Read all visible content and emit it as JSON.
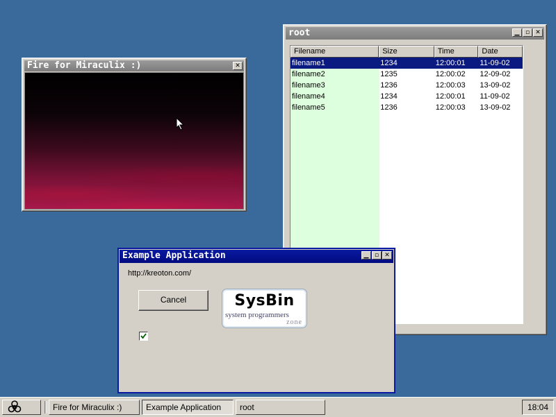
{
  "fire_window": {
    "title": "Fire for Miraculix :)",
    "close_glyph": "✕"
  },
  "root_window": {
    "title": "root",
    "columns": [
      "Filename",
      "Size",
      "Time",
      "Date"
    ],
    "rows": [
      {
        "filename": "filename1",
        "size": "1234",
        "time": "12:00:01",
        "date": "11-09-02"
      },
      {
        "filename": "filename2",
        "size": "1235",
        "time": "12:00:02",
        "date": "12-09-02"
      },
      {
        "filename": "filename3",
        "size": "1236",
        "time": "12:00:03",
        "date": "13-09-02"
      },
      {
        "filename": "filename4",
        "size": "1234",
        "time": "12:00:01",
        "date": "11-09-02"
      },
      {
        "filename": "filename5",
        "size": "1236",
        "time": "12:00:03",
        "date": "13-09-02"
      }
    ],
    "selected_row": 0
  },
  "example_window": {
    "title": "Example Application",
    "url_text": "http://kreoton.com/",
    "cancel_label": "Cancel",
    "logo": {
      "main": "SysBin",
      "sub": "system programmers",
      "zone": "zone"
    },
    "checkbox_checked": true
  },
  "taskbar": {
    "items": [
      "Fire for Miraculix :)",
      "Example Application",
      "root"
    ],
    "clock": "18:04",
    "start_icon": "biohazard-icon"
  },
  "colors": {
    "desktop": "#3a6a9c",
    "active_title": "#0a1aa0",
    "inactive_title": "#868686",
    "selection": "#0a1a80",
    "filename_column": "#ddffdd"
  }
}
